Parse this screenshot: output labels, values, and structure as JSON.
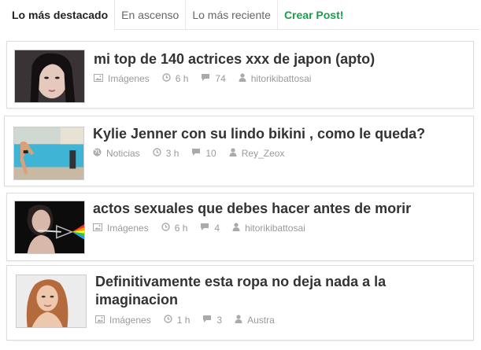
{
  "tabs": [
    {
      "label": "Lo más destacado"
    },
    {
      "label": "En ascenso"
    },
    {
      "label": "Lo más reciente"
    },
    {
      "label": "Crear Post!"
    }
  ],
  "posts": [
    {
      "title": "mi top de 140 actrices xxx de japon (apto)",
      "category": "Imágenes",
      "category_icon": "image-icon",
      "time": "6 h",
      "comments": "74",
      "author": "hitorikibattosai"
    },
    {
      "title": "Kylie Jenner con su lindo bikini , como le queda?",
      "category": "Noticias",
      "category_icon": "globe-icon",
      "time": "3 h",
      "comments": "10",
      "author": "Rey_Zeox"
    },
    {
      "title": "actos sexuales que debes hacer antes de morir",
      "category": "Imágenes",
      "category_icon": "image-icon",
      "time": "6 h",
      "comments": "4",
      "author": "hitorikibattosai"
    },
    {
      "title": "Definitivamente esta ropa no deja nada a la imaginacion",
      "category": "Imágenes",
      "category_icon": "image-icon",
      "time": "1 h",
      "comments": "3",
      "author": "Austra"
    }
  ],
  "colors": {
    "accent_green": "#1a9e4a",
    "meta_gray": "#9a9a9a",
    "title_dark": "#333333"
  }
}
